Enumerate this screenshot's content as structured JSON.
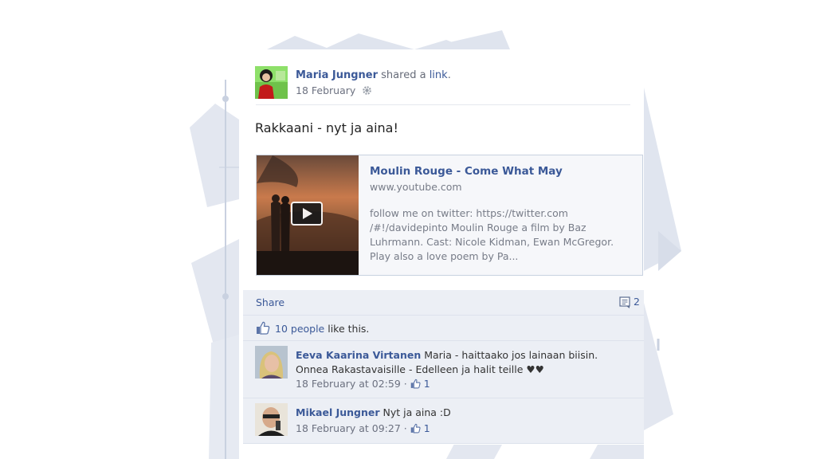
{
  "post": {
    "author": "Maria Jungner",
    "action_prefix": "shared a",
    "action_link": "link",
    "action_suffix": ".",
    "date": "18 February",
    "message": "Rakkaani - nyt ja aina!"
  },
  "attachment": {
    "title": "Moulin Rouge - Come What May",
    "domain": "www.youtube.com",
    "description": "follow me on twitter: https://twitter.com /#!/davidepinto Moulin Rouge a film by Baz Luhrmann. Cast: Nicole Kidman, Ewan McGregor. Play also a love poem by Pa..."
  },
  "actions": {
    "share_label": "Share",
    "comment_count": "2"
  },
  "likes": {
    "count_link": "10 people",
    "suffix": " like this."
  },
  "comments": [
    {
      "author": "Eeva Kaarina Virtanen",
      "text": "Maria - haittaako jos lainaan biisin. Onnea Rakastavaisille - Edelleen ja halit teille ♥♥",
      "time": "18 February at 02:59",
      "separator": "·",
      "likes": "1"
    },
    {
      "author": "Mikael Jungner",
      "text": "Nyt ja aina :D",
      "time": "18 February at 09:27",
      "separator": "·",
      "likes": "1"
    }
  ],
  "colors": {
    "link": "#3b5998",
    "panel": "#eceff5",
    "background_shapes": "#dfe4ee"
  },
  "icons": {
    "privacy": "gear-icon",
    "play": "play-icon",
    "comment": "comment-icon",
    "like": "thumbs-up-icon"
  }
}
